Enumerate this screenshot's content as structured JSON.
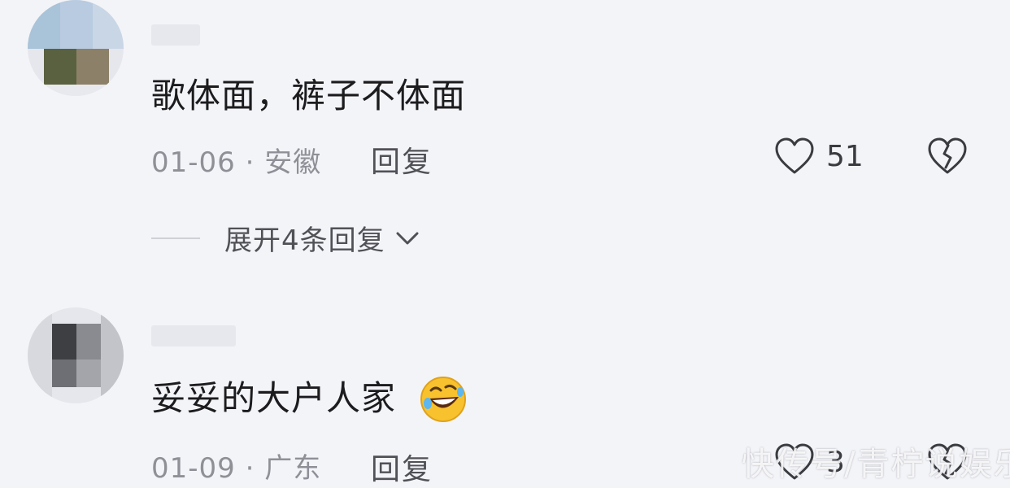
{
  "comments": [
    {
      "text": "歌体面，裤子不体面",
      "date_location": "01-06 · 安徽",
      "reply_label": "回复",
      "likes": "51",
      "expand_label": "展开4条回复"
    },
    {
      "text": "妥妥的大户人家",
      "emoji": "rolling-on-floor-laughing-emoji",
      "date_location": "01-09 · 广东",
      "reply_label": "回复",
      "likes": "3"
    }
  ],
  "watermark": "快传号/青柠说娱乐",
  "colors": {
    "background": "#f3f4f8",
    "text": "#1c1c1e",
    "meta": "#8f9097",
    "icon": "#3a3b40"
  }
}
